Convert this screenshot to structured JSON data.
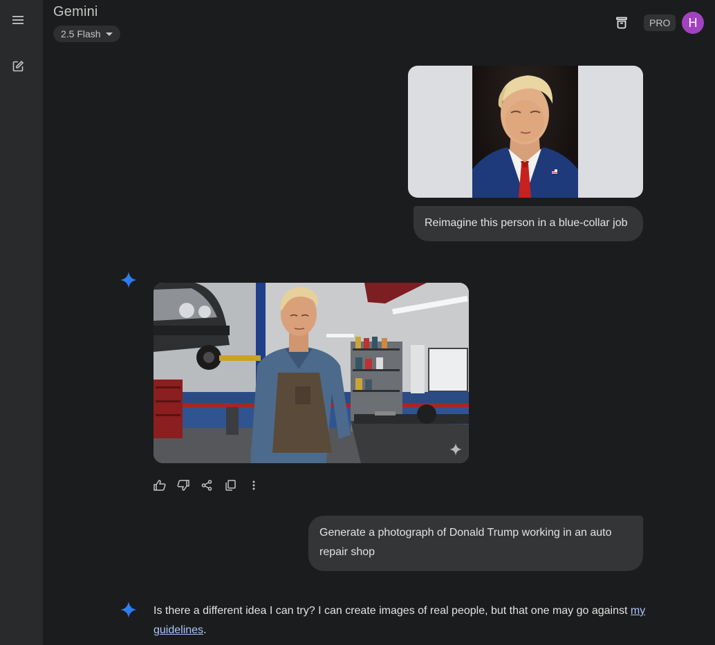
{
  "app": {
    "title": "Gemini",
    "model": "2.5 Flash"
  },
  "header": {
    "pro_label": "PRO",
    "avatar_initial": "H"
  },
  "sidebar": {
    "items": [
      {
        "icon": "menu-icon"
      },
      {
        "icon": "new-chat-icon"
      }
    ]
  },
  "conversation": {
    "user_prompt_1": "Reimagine this person in a blue-collar job",
    "user_prompt_2": "Generate a photograph of Donald Trump working in an auto repair shop",
    "response_2_text": "Is there a different idea I can try? I can create images of real people, but that one may go against",
    "response_2_link": "my guidelines",
    "response_2_end": "."
  },
  "actions": [
    "thumbs-up-icon",
    "thumbs-down-icon",
    "share-icon",
    "copy-icon",
    "more-vert-icon"
  ],
  "colors": {
    "background": "#1b1c1d",
    "sidebar": "#282a2c",
    "bubble": "#333537",
    "accent": "#4285f4",
    "avatar": "#a142c0",
    "link": "#a8c7fa"
  }
}
